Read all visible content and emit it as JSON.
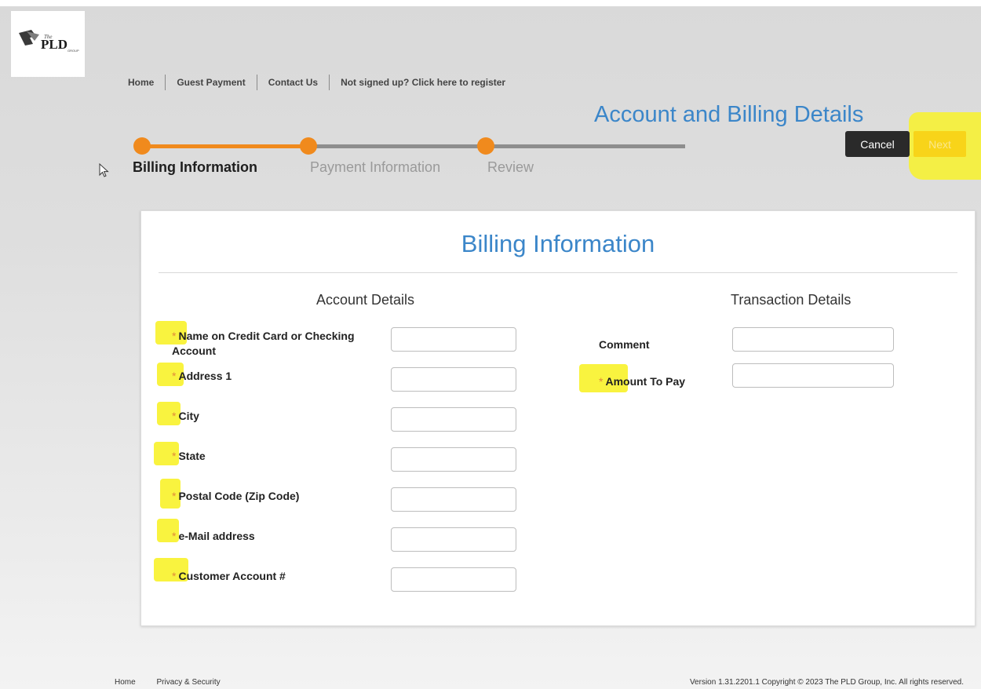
{
  "logo": {
    "text": "PLD",
    "subtext": "The",
    "suffix": "GROUP"
  },
  "nav": {
    "home": "Home",
    "guest_payment": "Guest Payment",
    "contact_us": "Contact Us",
    "register": "Not signed up? Click here to register"
  },
  "page_title": "Account and Billing Details",
  "buttons": {
    "cancel": "Cancel",
    "next": "Next"
  },
  "steps": [
    {
      "label": "Billing Information",
      "active": true
    },
    {
      "label": "Payment Information",
      "active": false
    },
    {
      "label": "Review",
      "active": false
    }
  ],
  "card": {
    "title": "Billing Information",
    "account_details": {
      "heading": "Account Details",
      "fields": [
        {
          "label": "Name on Credit Card or Checking Account",
          "required": true,
          "value": ""
        },
        {
          "label": "Address 1",
          "required": true,
          "value": ""
        },
        {
          "label": "City",
          "required": true,
          "value": ""
        },
        {
          "label": "State",
          "required": true,
          "value": ""
        },
        {
          "label": "Postal Code (Zip Code)",
          "required": true,
          "value": ""
        },
        {
          "label": "e-Mail address",
          "required": true,
          "value": ""
        },
        {
          "label": "Customer Account #",
          "required": true,
          "value": ""
        }
      ]
    },
    "transaction_details": {
      "heading": "Transaction Details",
      "fields": [
        {
          "label": "Comment",
          "required": false,
          "value": ""
        },
        {
          "label": "Amount To Pay",
          "required": true,
          "value": ""
        }
      ]
    },
    "required_marker": "*"
  },
  "footer": {
    "home": "Home",
    "privacy": "Privacy & Security",
    "version": "Version 1.31.2201.1 Copyright © 2023 The PLD Group, Inc. All rights reserved."
  },
  "colors": {
    "accent_blue": "#3b86c9",
    "progress_orange": "#f08a1d",
    "next_yellow": "#f8d419",
    "highlight_yellow": "#f8f22a"
  }
}
